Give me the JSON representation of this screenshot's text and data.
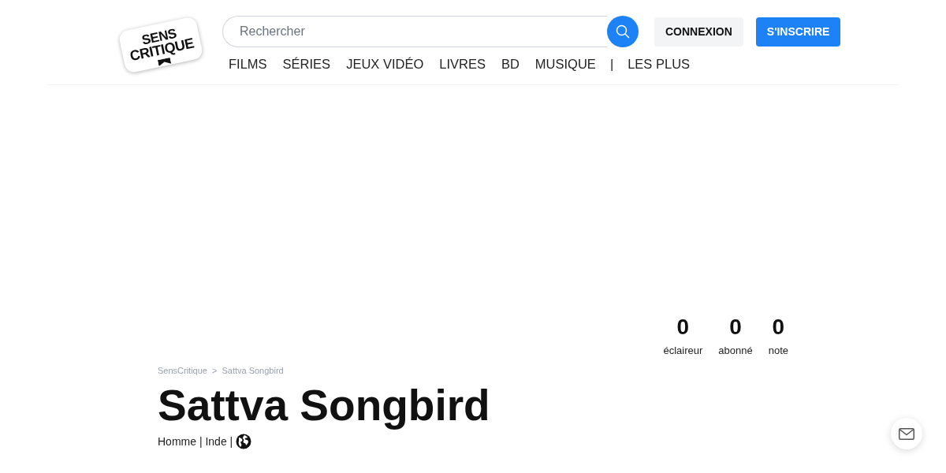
{
  "header": {
    "logo": {
      "lines": [
        "SENS",
        "CRITIQUE"
      ]
    },
    "search": {
      "placeholder": "Rechercher"
    },
    "buttons": [
      {
        "label": "CONNEXION",
        "kind": "secondary"
      },
      {
        "label": "S'INSCRIRE",
        "kind": "primary"
      }
    ],
    "nav": [
      {
        "label": "FILMS",
        "kind": "link"
      },
      {
        "label": "SÉRIES",
        "kind": "link"
      },
      {
        "label": "JEUX VIDÉO",
        "kind": "link"
      },
      {
        "label": "LIVRES",
        "kind": "link"
      },
      {
        "label": "BD",
        "kind": "link"
      },
      {
        "label": "MUSIQUE",
        "kind": "link"
      },
      {
        "label": "|",
        "kind": "separator"
      },
      {
        "label": "LES PLUS",
        "kind": "link"
      }
    ]
  },
  "stats": [
    {
      "value": "0",
      "label": "éclaireur"
    },
    {
      "value": "0",
      "label": "abonné"
    },
    {
      "value": "0",
      "label": "note"
    }
  ],
  "breadcrumb": {
    "items": [
      "SensCritique",
      "Sattva Songbird"
    ],
    "separator": ">"
  },
  "title": "Sattva Songbird",
  "details": {
    "text": "Homme | Inde |"
  }
}
